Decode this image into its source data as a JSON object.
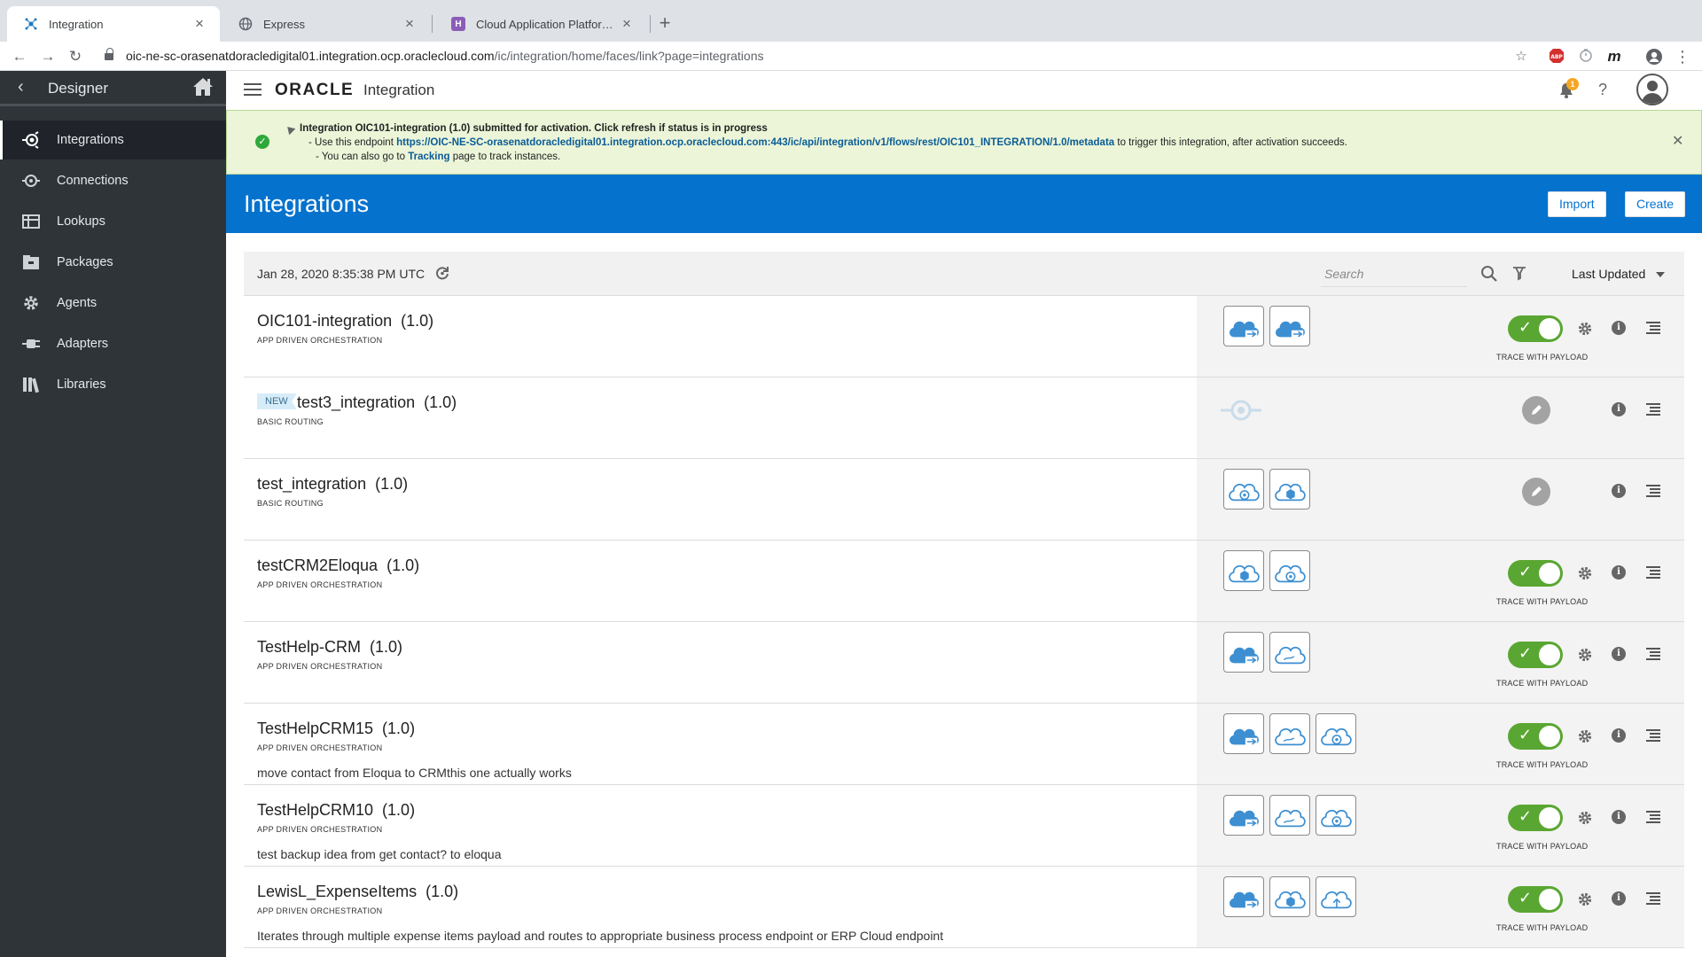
{
  "browser": {
    "tabs": [
      {
        "title": "Integration",
        "active": true
      },
      {
        "title": "Express",
        "active": false
      },
      {
        "title": "Cloud Application Platform | He",
        "active": false
      }
    ],
    "url_host": "oic-ne-sc-orasenatdoracledigital01.integration.ocp.oraclecloud.com",
    "url_path": "/ic/integration/home/faces/link?page=integrations"
  },
  "sidebar": {
    "title": "Designer",
    "items": [
      {
        "label": "Integrations",
        "icon": "integrations-icon",
        "active": true
      },
      {
        "label": "Connections",
        "icon": "connections-icon",
        "active": false
      },
      {
        "label": "Lookups",
        "icon": "lookups-icon",
        "active": false
      },
      {
        "label": "Packages",
        "icon": "packages-icon",
        "active": false
      },
      {
        "label": "Agents",
        "icon": "agents-icon",
        "active": false
      },
      {
        "label": "Adapters",
        "icon": "adapters-icon",
        "active": false
      },
      {
        "label": "Libraries",
        "icon": "libraries-icon",
        "active": false
      }
    ]
  },
  "header": {
    "logo": "ORACLE",
    "app_name": "Integration",
    "notification_count": "1",
    "help": "?"
  },
  "banner": {
    "title": "Integration OIC101-integration (1.0) submitted for activation. Click refresh if status is in progress",
    "line2_prefix": "- Use this endpoint ",
    "endpoint": "https://OIC-NE-SC-orasenatdoracledigital01.integration.ocp.oraclecloud.com:443/ic/api/integration/v1/flows/rest/OIC101_INTEGRATION/1.0/metadata",
    "line2_suffix": " to trigger this integration, after activation succeeds.",
    "line3_prefix": "- You can also go to ",
    "tracking_link": "Tracking",
    "line3_suffix": " page to track instances."
  },
  "page": {
    "title": "Integrations",
    "import_label": "Import",
    "create_label": "Create"
  },
  "list": {
    "timestamp": "Jan 28, 2020 8:35:38 PM UTC",
    "search_placeholder": "Search",
    "sort_label": "Last Updated",
    "trace_label": "TRACE WITH PAYLOAD",
    "rows": [
      {
        "name": "OIC101-integration",
        "version": "(1.0)",
        "type": "APP DRIVEN ORCHESTRATION",
        "description": "",
        "is_new": false,
        "status": "active",
        "trace": true
      },
      {
        "name": "test3_integration",
        "version": "(1.0)",
        "type": "BASIC ROUTING",
        "description": "",
        "is_new": true,
        "new_label": "NEW",
        "status": "draft",
        "trace": false
      },
      {
        "name": "test_integration",
        "version": "(1.0)",
        "type": "BASIC ROUTING",
        "description": "",
        "is_new": false,
        "status": "configured",
        "trace": false
      },
      {
        "name": "testCRM2Eloqua",
        "version": "(1.0)",
        "type": "APP DRIVEN ORCHESTRATION",
        "description": "",
        "is_new": false,
        "status": "active",
        "trace": true
      },
      {
        "name": "TestHelp-CRM",
        "version": "(1.0)",
        "type": "APP DRIVEN ORCHESTRATION",
        "description": "",
        "is_new": false,
        "status": "active",
        "trace": true
      },
      {
        "name": "TestHelpCRM15",
        "version": "(1.0)",
        "type": "APP DRIVEN ORCHESTRATION",
        "description": "move contact from Eloqua to CRMthis one actually works",
        "is_new": false,
        "status": "active",
        "trace": true
      },
      {
        "name": "TestHelpCRM10",
        "version": "(1.0)",
        "type": "APP DRIVEN ORCHESTRATION",
        "description": "test backup idea from get contact? to eloqua",
        "is_new": false,
        "status": "active",
        "trace": true
      },
      {
        "name": "LewisL_ExpenseItems",
        "version": "(1.0)",
        "type": "APP DRIVEN ORCHESTRATION",
        "description": "Iterates through multiple expense items payload and routes to appropriate business process endpoint or ERP Cloud endpoint",
        "is_new": false,
        "status": "active",
        "trace": true
      }
    ]
  },
  "colors": {
    "brand_blue": "#0572ce",
    "sidebar_bg": "#2f3439",
    "toggle_green": "#5aa632",
    "cloud_blue": "#3d8fd1",
    "banner_bg": "#ecf5d8"
  }
}
